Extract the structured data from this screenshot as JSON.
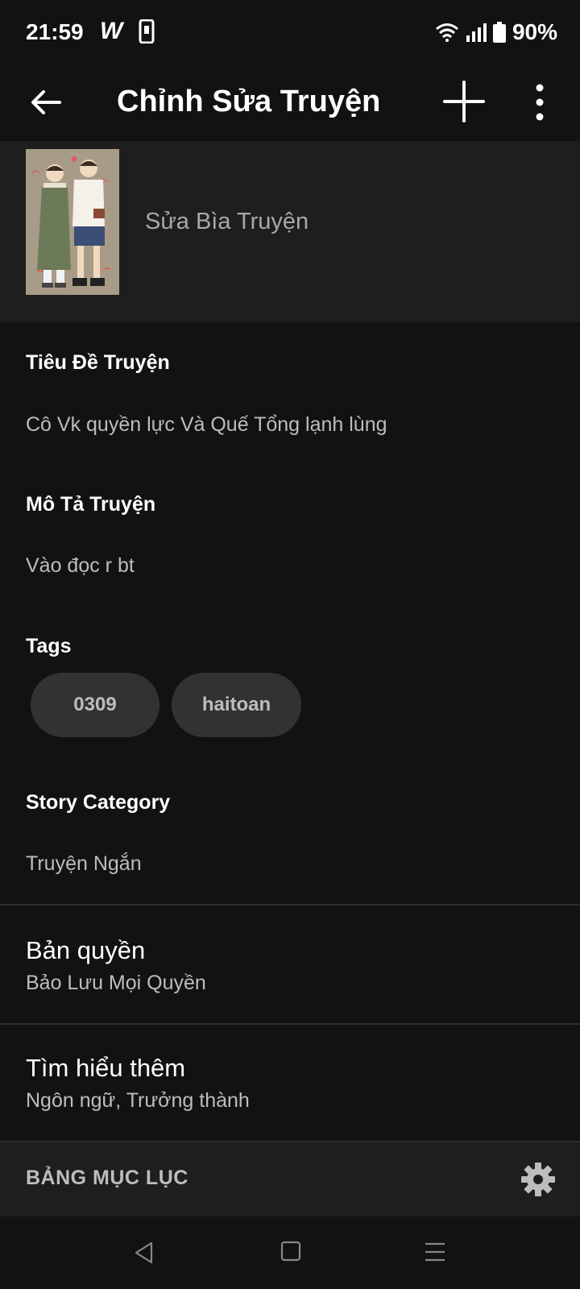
{
  "status_bar": {
    "time": "21:59",
    "app_icon": "W",
    "battery": "90%"
  },
  "app_bar": {
    "title": "Chỉnh Sửa Truyện"
  },
  "cover": {
    "label": "Sửa Bìa Truyện"
  },
  "story_title": {
    "label": "Tiêu Đề Truyện",
    "value": "Cô Vk quyền lực Và Quế Tổng lạnh lùng"
  },
  "description": {
    "label": "Mô Tả Truyện",
    "value": "Vào đọc r bt"
  },
  "tags": {
    "label": "Tags",
    "items": [
      "0309",
      "haitoan"
    ]
  },
  "category": {
    "label": "Story Category",
    "value": "Truyện Ngắn"
  },
  "copyright": {
    "title": "Bản quyền",
    "value": "Bảo Lưu Mọi Quyền"
  },
  "learn_more": {
    "title": "Tìm hiểu thêm",
    "value": "Ngôn ngữ, Trưởng thành"
  },
  "toc": {
    "label": "BẢNG MỤC LỤC"
  },
  "colors": {
    "background": "#121212",
    "surface": "#1e1e1e",
    "chip": "#323232",
    "text_primary": "#ffffff",
    "text_secondary": "#bdbdbd"
  }
}
